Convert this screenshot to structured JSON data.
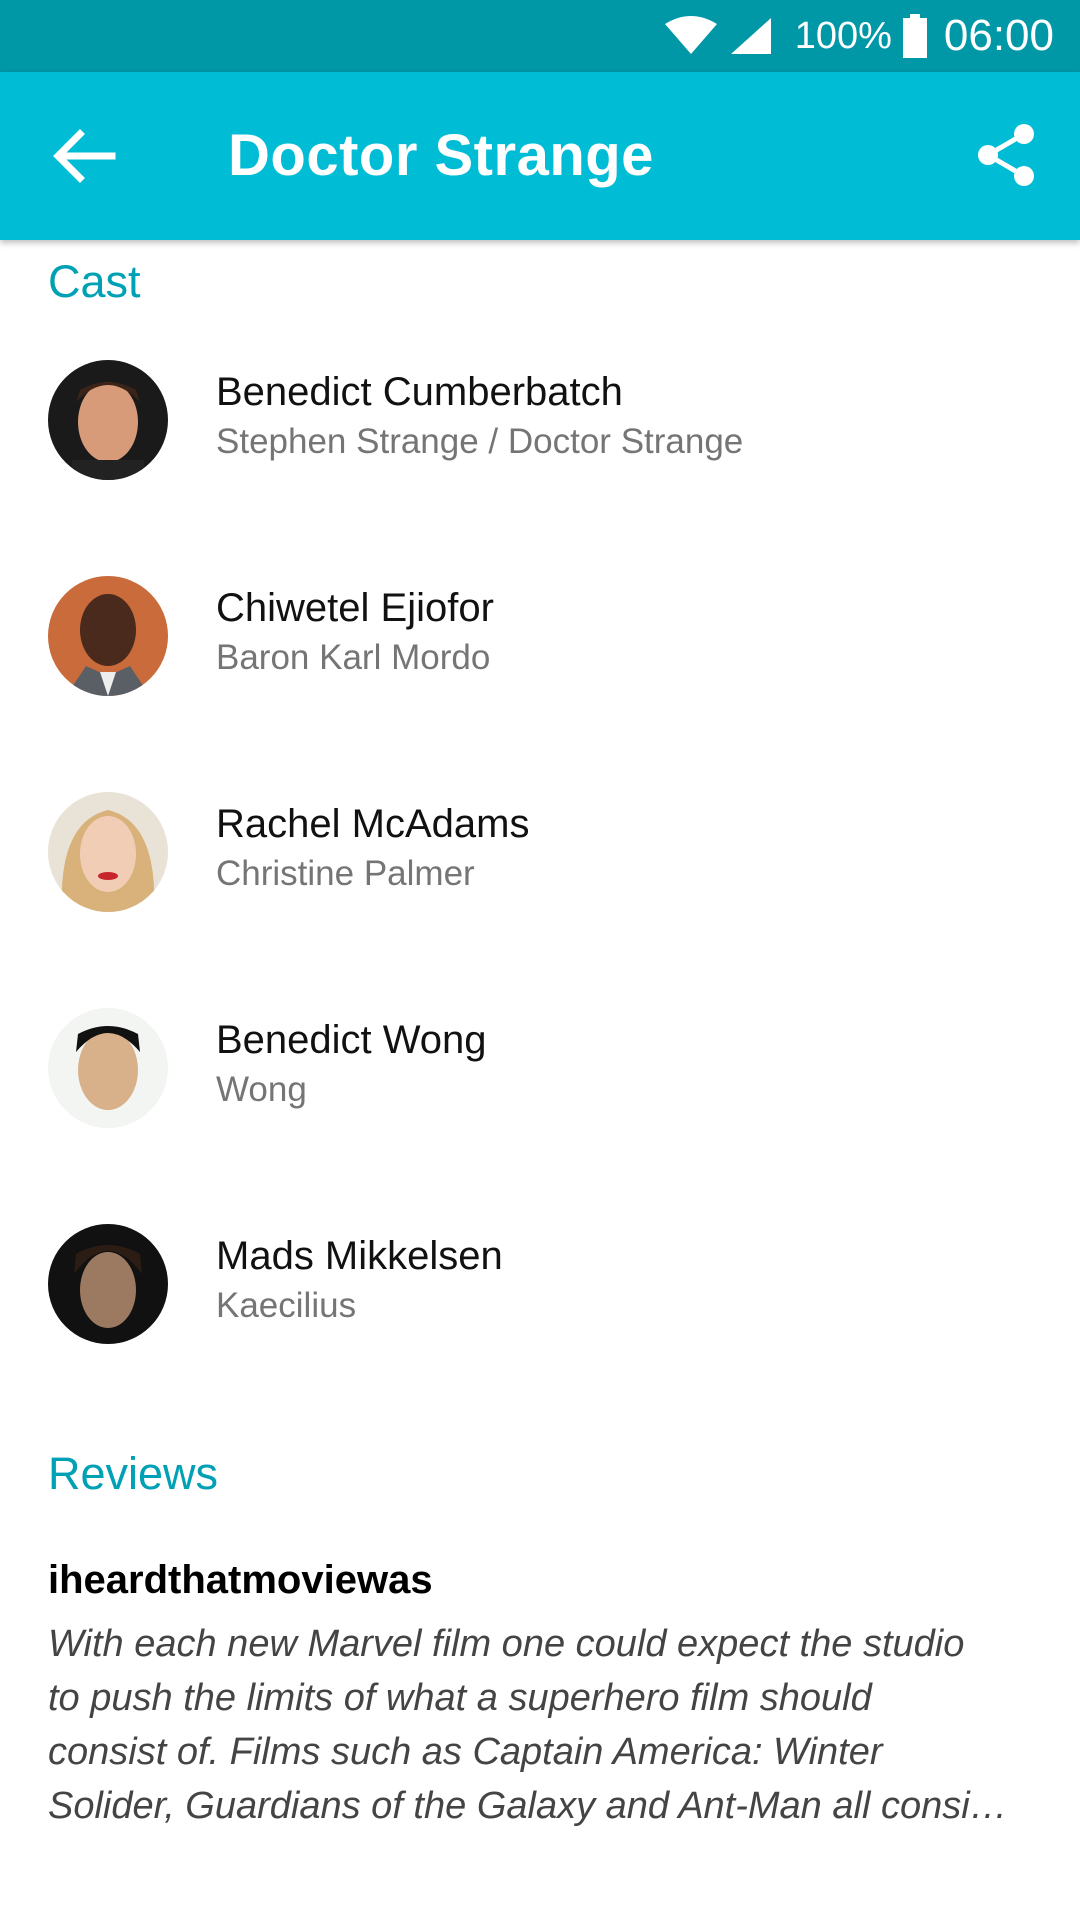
{
  "status_bar": {
    "battery_percent": "100%",
    "time": "06:00",
    "icons": [
      "wifi-icon",
      "signal-icon",
      "battery-icon"
    ]
  },
  "app_bar": {
    "title": "Doctor Strange",
    "back_icon": "arrow-back-icon",
    "share_icon": "share-icon",
    "color": "#00bcd4"
  },
  "cast": {
    "heading": "Cast",
    "items": [
      {
        "actor": "Benedict Cumberbatch",
        "character": "Stephen Strange / Doctor Strange"
      },
      {
        "actor": "Chiwetel Ejiofor",
        "character": "Baron Karl Mordo"
      },
      {
        "actor": "Rachel McAdams",
        "character": "Christine Palmer"
      },
      {
        "actor": "Benedict Wong",
        "character": "Wong"
      },
      {
        "actor": "Mads Mikkelsen",
        "character": "Kaecilius"
      }
    ]
  },
  "reviews": {
    "heading": "Reviews",
    "items": [
      {
        "author": "iheardthatmoviewas",
        "lines": [
          "With each new Marvel film one could expect the studio",
          "to push the limits of what a superhero film should",
          "consist of. Films such as Captain America: Winter",
          "Solider, Guardians of the Galaxy and Ant-Man all consi…"
        ]
      }
    ]
  },
  "colors": {
    "status_bar": "#0097a7",
    "accent": "#00a1b4",
    "secondary_text": "#757575"
  }
}
